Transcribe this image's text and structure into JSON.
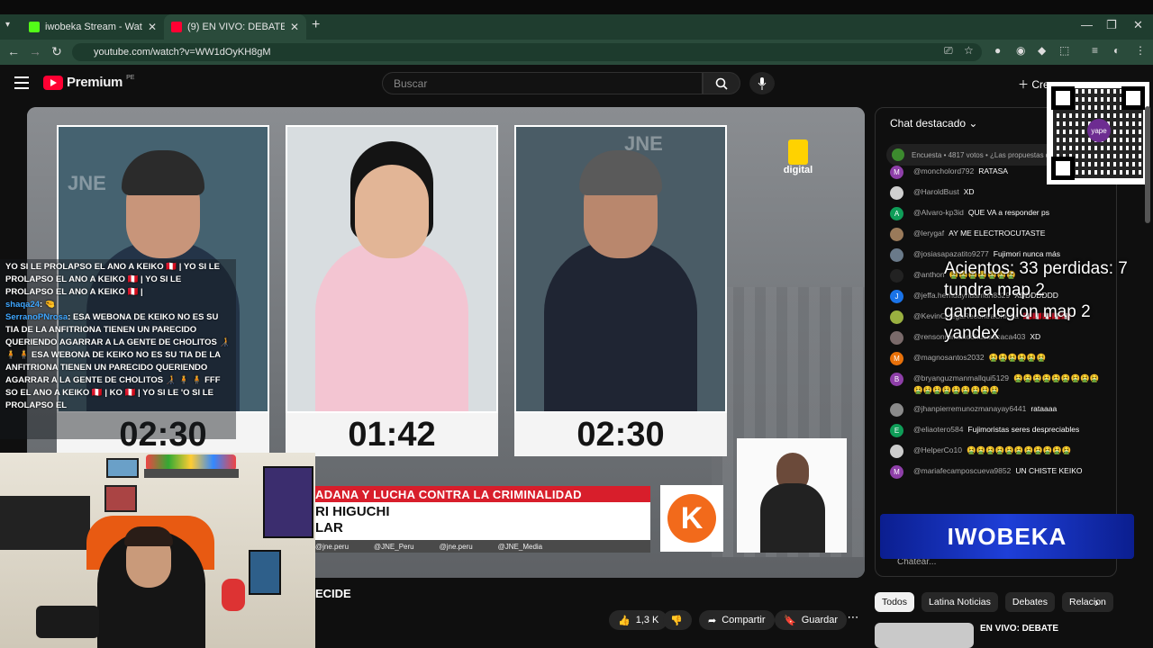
{
  "browser": {
    "tabs": [
      {
        "title": "iwobeka Stream - Watch Live o",
        "close": "✕"
      },
      {
        "title": "(9) EN VIVO: DEBATE PRESI",
        "close": "✕"
      }
    ],
    "url": "youtube.com/watch?v=WW1dOyKH8gM",
    "new_tab": "+",
    "win_min": "—",
    "win_max": "❐",
    "win_close": "✕"
  },
  "yt": {
    "logo": "Premium",
    "region": "PE",
    "search_placeholder": "Buscar",
    "create_label": "Cre"
  },
  "video": {
    "timers": [
      "02:30",
      "01:42",
      "02:30"
    ],
    "brand": "digital",
    "lower_red": "ADANA Y LUCHA CONTRA LA CRIMINALIDAD",
    "lower_white_1": "RI HIGUCHI",
    "lower_white_2": "LAR",
    "socials": [
      "@jne.peru",
      "@JNE_Peru",
      "@jne.peru",
      "@JNE_Media"
    ],
    "k_logo": "K",
    "jne_text": "JNE"
  },
  "stream_overlay_chat": [
    {
      "text": "YO SI LE PROLAPSO EL ANO A KEIKO 🇵🇪 | YO SI LE PROLAPSO EL ANO A KEIKO 🇵🇪 | YO SI LE PROLAPSO EL ANO A KEIKO 🇵🇪 |"
    },
    {
      "name": "shaqa24",
      "text": ": 🤏"
    },
    {
      "name": "SerranoPNrosa",
      "text": ": ESA WEBONA DE KEIKO NO ES SU TIA DE LA ANFITRIONA TIENEN UN PARECIDO QUERIENDO AGARRAR A LA GENTE DE CHOLITOS 🧑‍🦯 🧍 🧍 ESA WEBONA DE KEIKO NO ES SU TIA DE LA ANFITRIONA TIENEN UN PARECIDO QUERIENDO AGARRAR A LA GENTE DE CHOLITOS 🧑‍🦯 🧍 🧍 FFF"
    },
    {
      "text": "SO EL ANO A KEIKO 🇵🇪 | KO 🇵🇪 | YO SI LE 'O SI LE PROLAPSO EL"
    }
  ],
  "below_video": {
    "title_fragment": "ECIDE",
    "like_count": "1,3 K",
    "share": "Compartir",
    "save": "Guardar",
    "more": "⋯"
  },
  "chat": {
    "header": "Chat destacado",
    "poll": "Encuesta • 4817 votos • ¿Las propuestas q",
    "messages": [
      {
        "user": "@moncholord792",
        "text": "RATASA",
        "avatar": "M",
        "color": "#8e3fa8"
      },
      {
        "user": "@HaroldBust",
        "text": "XD",
        "avatar": "",
        "color": "#cfcfcf"
      },
      {
        "user": "@Alvaro-kp3id",
        "text": "QUE VA a responder ps",
        "avatar": "A",
        "color": "#0f9d58"
      },
      {
        "user": "@lerygaf",
        "text": "AY ME ELECTROCUTASTE",
        "avatar": "",
        "color": "#9a7a5a"
      },
      {
        "user": "@josiasapazatito9277",
        "text": "Fujimori nunca más",
        "avatar": "",
        "color": "#6a7a8a"
      },
      {
        "user": "@anthon",
        "text": "🤮🤮🤮🤮🤮🤮🤮",
        "avatar": "",
        "color": "#222222"
      },
      {
        "user": "@jeffa.herhuayhuaman8329",
        "text": "XDDDDDDD",
        "avatar": "J",
        "color": "#1a73e8"
      },
      {
        "user": "@KevinOrtegaRecontraChicha",
        "text": "🇵🇪🇵🇪🇵🇪🇵🇪🇵🇪",
        "avatar": "",
        "color": "#9ab040"
      },
      {
        "user": "@rensonromariochusisacaca403",
        "text": "XD",
        "avatar": "",
        "color": "#7a6a6a"
      },
      {
        "user": "@magnosantos2032",
        "text": "🤮🤮🤮🤮🤮🤮",
        "avatar": "M",
        "color": "#e8710a"
      },
      {
        "user": "@bryanguzmanmallqui5129",
        "text": "🤮🤮🤮🤮🤮🤮🤮🤮🤮🤮🤮🤮🤮🤮🤮🤮🤮🤮",
        "avatar": "B",
        "color": "#8e3fa8"
      },
      {
        "user": "@jhanpierremunozmanayay6441",
        "text": "rataaaa",
        "avatar": "",
        "color": "#8a8a8a"
      },
      {
        "user": "@eliaotero584",
        "text": "Fujimoristas seres despreciables",
        "avatar": "E",
        "color": "#0f9d58"
      },
      {
        "user": "@HelperCo10",
        "text": "🤮🤮🤮🤮🤮🤮🤮🤮🤮🤮🤮",
        "avatar": "",
        "color": "#cccccc"
      },
      {
        "user": "@mariafecamposcueva9852",
        "text": "UN CHISTE KEIKO",
        "avatar": "M",
        "color": "#8e3fa8"
      }
    ],
    "input_placeholder": "Chatear..."
  },
  "qr_label": "yape",
  "overlay_stats": [
    "Acientos: 33 perdidas: 7",
    "tundra map 2",
    "gamerlegion map 2",
    "yandex"
  ],
  "iwobeka_banner": "IWOBEKA",
  "chips": [
    "Todos",
    "Latina Noticias",
    "Debates",
    "Relacion"
  ],
  "recommended": {
    "title": "EN VIVO: DEBATE"
  }
}
